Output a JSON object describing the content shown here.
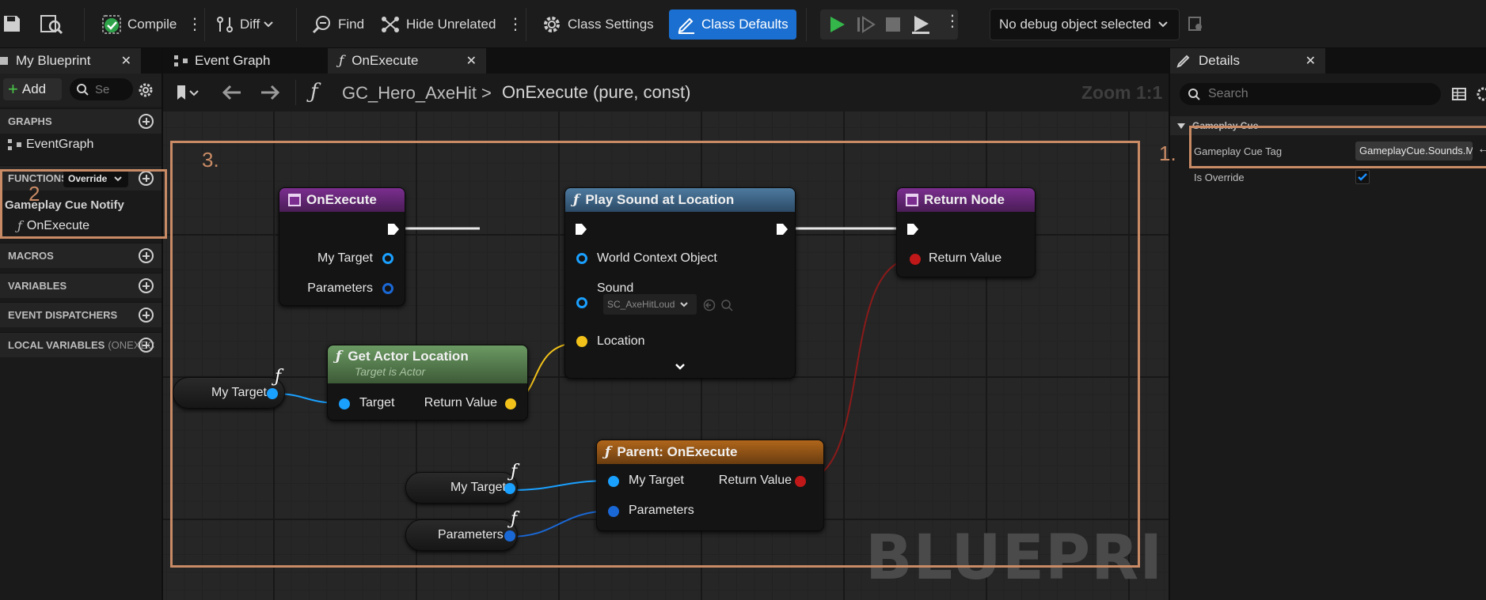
{
  "toolbar": {
    "compile": "Compile",
    "diff": "Diff",
    "find": "Find",
    "hide_unrelated": "Hide Unrelated",
    "class_settings": "Class Settings",
    "class_defaults": "Class Defaults",
    "debug_object": "No debug object selected",
    "accent": "#1b6fd0"
  },
  "left_panel": {
    "tab": "My Blueprint",
    "add": "Add",
    "search_placeholder": "Se",
    "sections": {
      "graphs": "GRAPHS",
      "event_graph": "EventGraph",
      "functions": "FUNCTIONS",
      "override": "Override",
      "category": "Gameplay Cue Notify",
      "function_item": "OnExecute",
      "macros": "MACROS",
      "variables": "VARIABLES",
      "event_dispatchers": "EVENT DISPATCHERS",
      "local_variables": "LOCAL VARIABLES",
      "local_variables_suffix": "(ONEXEC"
    }
  },
  "graph": {
    "tabs": [
      "Event Graph",
      "OnExecute"
    ],
    "breadcrumb_root": "GC_Hero_AxeHit",
    "breadcrumb_current": "OnExecute (pure, const)",
    "zoom": "Zoom 1:1",
    "watermark": "BLUEPRINT",
    "nodes": {
      "on_execute": {
        "title": "OnExecute",
        "pins": [
          "My Target",
          "Parameters"
        ]
      },
      "play_sound": {
        "title": "Play Sound at Location",
        "pins": [
          "World Context Object",
          "Sound",
          "Location"
        ],
        "sound_value": "SC_AxeHitLoud"
      },
      "return_node": {
        "title": "Return Node",
        "pins": [
          "Return Value"
        ]
      },
      "get_actor_location": {
        "title": "Get Actor Location",
        "subtitle": "Target is Actor",
        "pin_in": "Target",
        "pin_out": "Return Value"
      },
      "parent_on_execute": {
        "title": "Parent: OnExecute",
        "pins": [
          "My Target",
          "Parameters"
        ],
        "pin_out": "Return Value"
      },
      "var_my_target_1": "My Target",
      "var_my_target_2": "My Target",
      "var_parameters": "Parameters"
    }
  },
  "details": {
    "tab": "Details",
    "search_placeholder": "Search",
    "category": "Gameplay Cue",
    "props": [
      {
        "label": "Gameplay Cue Tag",
        "value": "GameplayCue.Sounds.Me"
      },
      {
        "label": "Is Override",
        "value": "checked"
      }
    ]
  },
  "annotations": [
    "1.",
    "2",
    "3."
  ]
}
